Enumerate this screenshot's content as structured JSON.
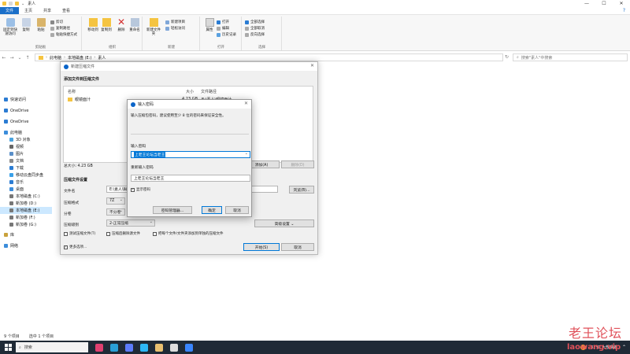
{
  "window": {
    "title": "素人",
    "controls": [
      "—",
      "☐",
      "✕"
    ]
  },
  "tabs": [
    {
      "label": "文件",
      "active": true
    },
    {
      "label": "主页"
    },
    {
      "label": "共享"
    },
    {
      "label": "查看"
    }
  ],
  "ribbon": {
    "clipboard": {
      "label": "剪贴板",
      "pin": "固定到快速访问",
      "copy": "复制",
      "paste": "粘贴",
      "cut": "剪切",
      "copy_path": "复制路径",
      "paste_shortcut": "粘贴快捷方式"
    },
    "organize": {
      "label": "组织",
      "move_to": "移动到",
      "copy_to": "复制到",
      "delete": "删除",
      "rename": "重命名"
    },
    "new": {
      "label": "新建",
      "new_folder": "新建文件夹",
      "new_item": "新建项目",
      "easy_access": "轻松访问"
    },
    "open": {
      "label": "打开",
      "properties": "属性",
      "open": "打开",
      "edit": "编辑",
      "history": "历史记录"
    },
    "select": {
      "label": "选择",
      "select_all": "全部选择",
      "select_none": "全部取消",
      "invert": "反向选择"
    }
  },
  "address": {
    "path": [
      "此电脑",
      "本地磁盘 (E:)",
      "素人"
    ],
    "search_placeholder": "搜索\"素人\"中搜索"
  },
  "nav": {
    "items": [
      {
        "label": "快速访问",
        "icon": "star-icon",
        "color": "#2b7cd3"
      },
      {
        "label": "OneDrive",
        "icon": "cloud-icon",
        "color": "#2b7cd3"
      },
      {
        "label": "OneDrive",
        "icon": "cloud-icon",
        "color": "#2b7cd3"
      },
      {
        "label": "此电脑",
        "icon": "computer-icon",
        "color": "#3c8ddb"
      },
      {
        "label": "3D 对象",
        "icon": "cube-icon",
        "color": "#4aa3df"
      },
      {
        "label": "视频",
        "icon": "video-icon",
        "color": "#666666"
      },
      {
        "label": "图片",
        "icon": "picture-icon",
        "color": "#5a8fc9"
      },
      {
        "label": "文档",
        "icon": "document-icon",
        "color": "#8a8a8a"
      },
      {
        "label": "下载",
        "icon": "download-icon",
        "color": "#2b7cd3"
      },
      {
        "label": "移动云盘同步盘",
        "icon": "cloud-drive-icon",
        "color": "#3aa0e8"
      },
      {
        "label": "音乐",
        "icon": "music-icon",
        "color": "#2b7cd3"
      },
      {
        "label": "桌面",
        "icon": "desktop-icon",
        "color": "#3c8ddb"
      },
      {
        "label": "本地磁盘 (C:)",
        "icon": "drive-icon",
        "color": "#777777"
      },
      {
        "label": "新加卷 (D:)",
        "icon": "drive-icon",
        "color": "#777777"
      },
      {
        "label": "本地磁盘 (E:)",
        "icon": "drive-icon",
        "color": "#777777",
        "selected": true
      },
      {
        "label": "新加卷 (F:)",
        "icon": "drive-icon",
        "color": "#777777"
      },
      {
        "label": "新加卷 (G:)",
        "icon": "drive-icon",
        "color": "#777777"
      },
      {
        "label": "库",
        "icon": "library-icon",
        "color": "#c9a23c"
      },
      {
        "label": "网络",
        "icon": "network-icon",
        "color": "#3c8ddb"
      }
    ]
  },
  "status": {
    "count": "9 个项目",
    "selected": "选中 1 个项目"
  },
  "archive_dialog": {
    "title": "新建压缩文件",
    "add_section": "添加文件到压缩文件",
    "col_name": "名称",
    "col_size": "大小",
    "col_path": "文件路径",
    "file": {
      "name": "眼镜面汁",
      "size": "4.23 GB",
      "path": "E:\\素人\\眼镜面汁"
    },
    "total_size": "总大小: 4.23 GB",
    "add_button": "添加(A)",
    "remove_button": "删除(D)",
    "settings_section": "压缩文件设置",
    "filename_label": "文件名",
    "filename_value": "E:\\素人\\眼",
    "browse_button": "浏览(B)...",
    "format_label": "压缩格式",
    "format_value": "7Z",
    "split_label": "分卷",
    "split_value": "不分卷",
    "level_label": "压缩级别",
    "level_value": "2-正常压缩",
    "advanced_button": "高级设置 ⌄",
    "chk_test": "测试压缩文件(T)",
    "chk_delete": "压缩后删除源文件",
    "chk_each": "把每个文件/文件夹添加到单独的压缩文件",
    "more_options": "更多选项...",
    "start_button": "开始(S)",
    "cancel_button": "取消"
  },
  "password_dialog": {
    "title": "输入密码",
    "note": "输入压缩包密码，建议使用至少 8 位的密码来保证安全性。",
    "enter_label": "输入密码",
    "enter_value": "上老王论坛当老王",
    "reenter_label": "重新输入密码",
    "reenter_value": "上老王论坛当老王",
    "show_password": "显示密码",
    "manager_button": "密码管理器...",
    "ok_button": "确定",
    "cancel_button": "取消"
  },
  "taskbar": {
    "search": "搜索",
    "weather": "32°C 大部晴朗",
    "icons": [
      {
        "name": "app-icon-1",
        "color": "#e04070"
      },
      {
        "name": "edge-icon",
        "color": "#2a9fd6"
      },
      {
        "name": "app-icon-3",
        "color": "#5c7cfa"
      },
      {
        "name": "app-icon-4",
        "color": "#2db7f5"
      },
      {
        "name": "app-icon-5",
        "color": "#e8c070"
      },
      {
        "name": "app-icon-6",
        "color": "#dddddd"
      },
      {
        "name": "app-icon-7",
        "color": "#3a86ff"
      }
    ]
  },
  "watermark": {
    "line1": "老王论坛",
    "line2": "laowang.vip"
  }
}
